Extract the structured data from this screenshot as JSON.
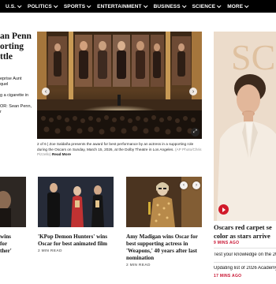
{
  "nav": {
    "items": [
      "U.S.",
      "POLITICS",
      "SPORTS",
      "ENTERTAINMENT",
      "BUSINESS",
      "SCIENCE",
      "MORE"
    ]
  },
  "left": {
    "headline_lines": [
      "an Penn",
      "orting",
      "ttle"
    ],
    "links": [
      {
        "text": "eprise Aunt",
        "red": false
      },
      {
        "text": "quel",
        "red": false
      },
      {
        "text": "g a cigarette in",
        "red": false
      },
      {
        "text": "OR: Sean Penn,",
        "red": false
      },
      {
        "text": "r",
        "red": false
      }
    ]
  },
  "slideshow": {
    "prev_icon": "chevron-left-icon",
    "next_icon": "chevron-right-icon",
    "expand_icon": "expand-icon",
    "caption": "2 of 6 | Zoe Saldaña presents the award for best performance by an actress in a supporting role during the Oscars on Sunday, March 15, 2026, at the Dolby Theatre in Los Angeles.",
    "credit": " (AP Photo/Chris Pizzello)",
    "read_more": "Read More"
  },
  "feature": {
    "title_lines": [
      "Oscars red carpet se",
      "color as stars arrive"
    ],
    "time": "9 MINS AGO",
    "related": [
      {
        "text": "Test your knowledge on the 20",
        "time": ""
      },
      {
        "text": "Updating list of 2026 Academy",
        "time": "17 MINS AGO"
      }
    ],
    "play_icon": "play-icon"
  },
  "cards": [
    {
      "title_lines": [
        "wins",
        "for",
        "ther'"
      ],
      "time": ""
    },
    {
      "title_lines": [
        "'KPop Demon Hunters' wins",
        "Oscar for best animated film"
      ],
      "time": "2 MIN READ"
    },
    {
      "title_lines": [
        "Amy Madigan wins Oscar for",
        "best supporting actress in",
        "'Weapons,' 40 years after last",
        "nomination"
      ],
      "time": "2 MIN READ"
    }
  ]
}
